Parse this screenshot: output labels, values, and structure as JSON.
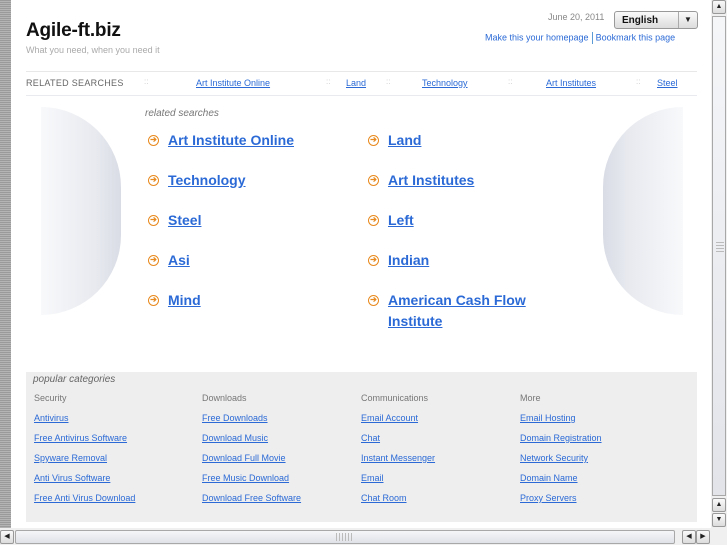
{
  "header": {
    "site_title": "Agile-ft.biz",
    "tagline": "What you need, when you need it",
    "date": "June 20, 2011",
    "language": "English",
    "links": [
      "Make this your homepage",
      "Bookmark this page"
    ]
  },
  "related_bar": {
    "label": "RELATED SEARCHES",
    "separator": "::",
    "links": [
      "Art Institute Online",
      "Land",
      "Technology",
      "Art Institutes",
      "Steel"
    ]
  },
  "related_searches": {
    "label": "related searches",
    "left": [
      "Art Institute Online",
      "Technology",
      "Steel",
      "Asi",
      "Mind"
    ],
    "right": [
      "Land",
      "Art Institutes",
      "Left",
      "Indian",
      "American Cash Flow Institute"
    ]
  },
  "popular": {
    "title": "popular categories",
    "columns": [
      {
        "heading": "Security",
        "links": [
          "Antivirus",
          "Free Antivirus Software",
          "Spyware Removal",
          "Anti Virus Software",
          "Free Anti Virus Download"
        ]
      },
      {
        "heading": "Downloads",
        "links": [
          "Free Downloads",
          "Download Music",
          "Download Full Movie",
          "Free Music Download",
          "Download Free Software"
        ]
      },
      {
        "heading": "Communications",
        "links": [
          "Email Account",
          "Chat",
          "Instant Messenger",
          "Email",
          "Chat Room"
        ]
      },
      {
        "heading": "More",
        "links": [
          "Email Hosting",
          "Domain Registration",
          "Network Security",
          "Domain Name",
          "Proxy Servers"
        ]
      }
    ]
  },
  "icons": {
    "arrow": "➔",
    "up": "▲",
    "down": "▼",
    "left": "◀",
    "right": "▶"
  },
  "colors": {
    "link": "#2b6ad6",
    "accent_arrow": "#e8891e",
    "popular_bg": "#eeeeee"
  }
}
